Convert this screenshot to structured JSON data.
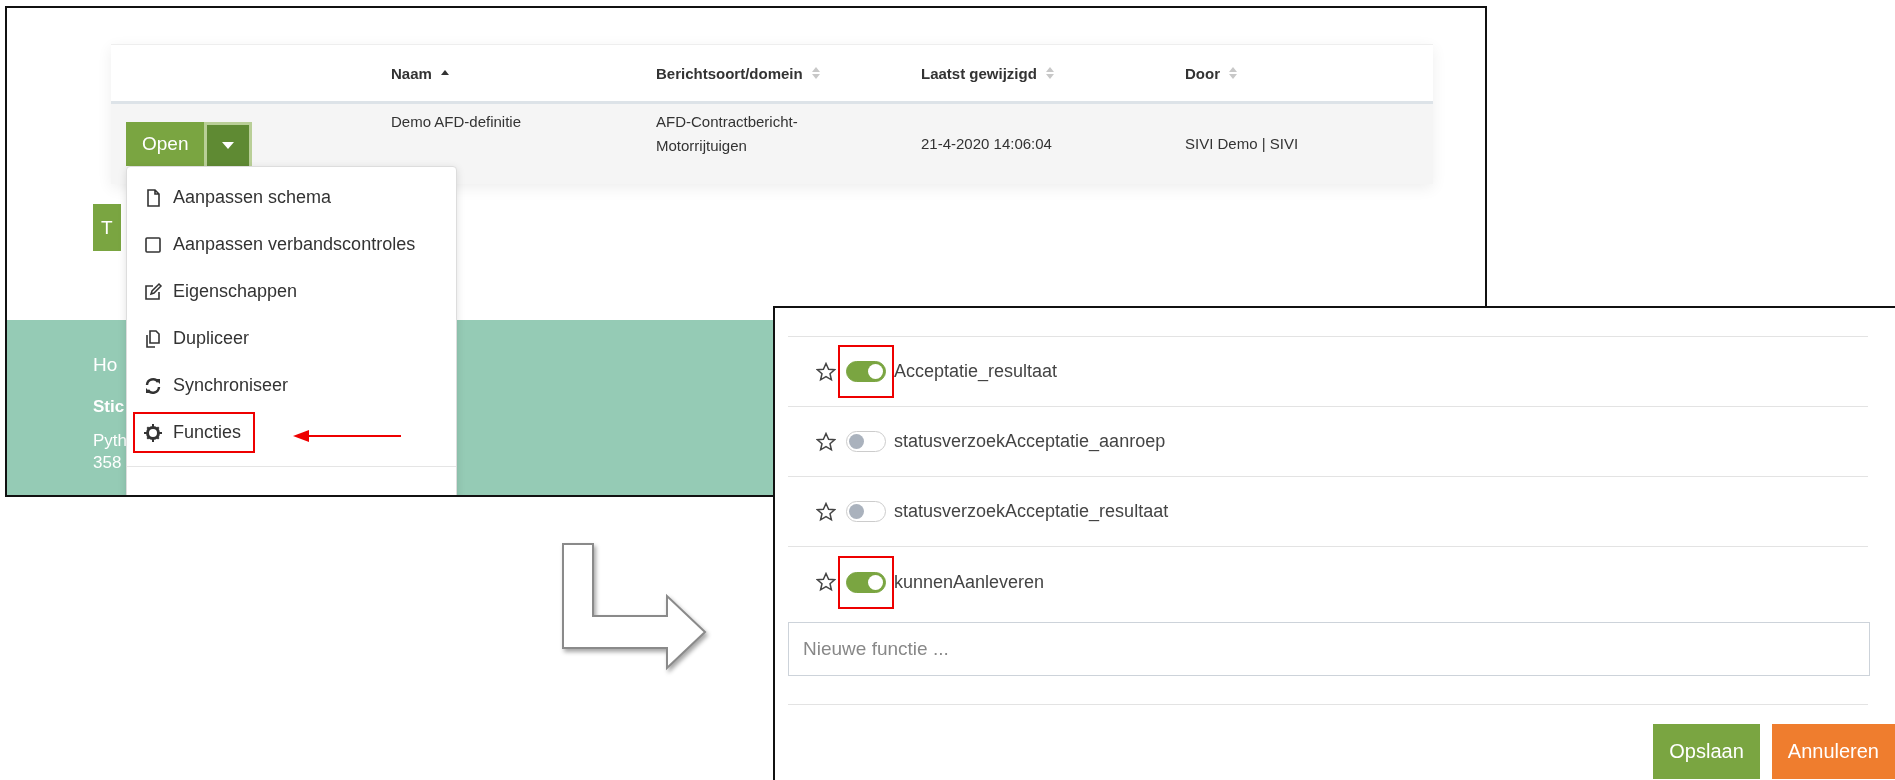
{
  "screenshot_1": {
    "table": {
      "columns": [
        {
          "label": "Naam",
          "sorted": true
        },
        {
          "label": "Berichtsoort/domein",
          "sorted": false
        },
        {
          "label": "Laatst gewijzigd",
          "sorted": false
        },
        {
          "label": "Door",
          "sorted": false
        }
      ],
      "rows": [
        {
          "open_button": "Open",
          "cells": [
            "Demo AFD-definitie",
            "AFD-Contractbericht-Motorrijtuigen",
            "21-4-2020 14:06:04",
            "SIVI Demo | SIVI"
          ]
        }
      ]
    },
    "button_behind_menu": "T",
    "dropdown_menu": [
      {
        "kind": "file",
        "label": "Aanpassen schema",
        "highlighted": false,
        "arrow": false
      },
      {
        "kind": "square",
        "label": "Aanpassen verbandscontroles",
        "highlighted": false,
        "arrow": false
      },
      {
        "kind": "edit",
        "label": "Eigenschappen",
        "highlighted": false,
        "arrow": false
      },
      {
        "kind": "copy",
        "label": "Dupliceer",
        "highlighted": false,
        "arrow": false
      },
      {
        "kind": "sync",
        "label": "Synchroniseer",
        "highlighted": false,
        "arrow": false
      },
      {
        "kind": "gear",
        "label": "Functies",
        "highlighted": true,
        "arrow": true
      }
    ],
    "footer": [
      {
        "text": "Ho",
        "bold": false
      },
      {
        "text": "Stic",
        "bold": true
      },
      {
        "text": "Pyth",
        "bold": false
      },
      {
        "text": "358",
        "bold": false
      }
    ]
  },
  "screenshot_2": {
    "functions": [
      {
        "name": "Acceptatie_resultaat",
        "starred": false,
        "on": true,
        "highlighted": true
      },
      {
        "name": "statusverzoekAcceptatie_aanroep",
        "starred": false,
        "on": false,
        "highlighted": false
      },
      {
        "name": "statusverzoekAcceptatie_resultaat",
        "starred": false,
        "on": false,
        "highlighted": false
      },
      {
        "name": "kunnenAanleveren",
        "starred": false,
        "on": true,
        "highlighted": true
      }
    ],
    "new_function": {
      "placeholder": "Nieuwe functie ..."
    },
    "buttons": [
      {
        "label": "Opslaan",
        "kind": "primary"
      },
      {
        "label": "Annuleren",
        "kind": "cancel"
      }
    ]
  }
}
